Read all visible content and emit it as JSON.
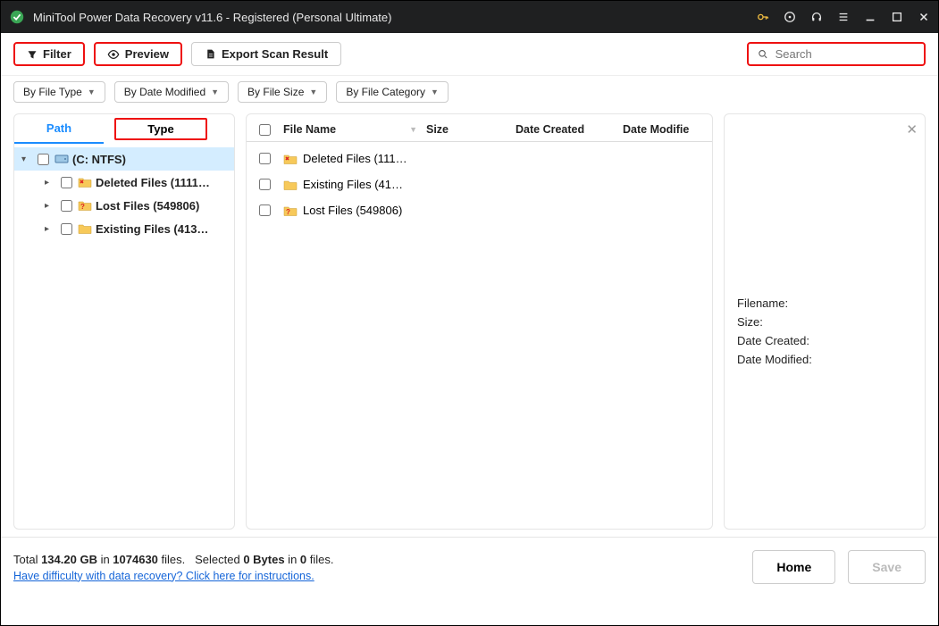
{
  "titlebar": {
    "title": "MiniTool Power Data Recovery v11.6 - Registered (Personal Ultimate)"
  },
  "toolbar": {
    "filter_label": "Filter",
    "preview_label": "Preview",
    "export_label": "Export Scan Result",
    "search_placeholder": "Search"
  },
  "chips": {
    "by_type": "By File Type",
    "by_date": "By Date Modified",
    "by_size": "By File Size",
    "by_cat": "By File Category"
  },
  "tabs": {
    "path": "Path",
    "type": "Type"
  },
  "tree": {
    "root": "(C: NTFS)",
    "items": [
      {
        "label": "Deleted Files (1111…",
        "icon": "x"
      },
      {
        "label": "Lost Files (549806)",
        "icon": "q"
      },
      {
        "label": "Existing Files (413…",
        "icon": "f"
      }
    ]
  },
  "table": {
    "headers": {
      "name": "File Name",
      "size": "Size",
      "created": "Date Created",
      "modified": "Date Modifie"
    },
    "rows": [
      {
        "label": "Deleted Files (111…",
        "icon": "x"
      },
      {
        "label": "Existing Files (41…",
        "icon": "f"
      },
      {
        "label": "Lost Files (549806)",
        "icon": "q"
      }
    ]
  },
  "details": {
    "filename": "Filename:",
    "size": "Size:",
    "created": "Date Created:",
    "modified": "Date Modified:"
  },
  "footer": {
    "total_prefix": "Total ",
    "total_size": "134.20 GB",
    "total_mid": " in ",
    "total_count": "1074630",
    "total_suffix": " files.",
    "selected_prefix": "Selected ",
    "selected_bytes": "0 Bytes",
    "selected_mid": " in ",
    "selected_count": "0",
    "selected_suffix": " files.",
    "help_link": "Have difficulty with data recovery? Click here for instructions.",
    "home": "Home",
    "save": "Save"
  }
}
